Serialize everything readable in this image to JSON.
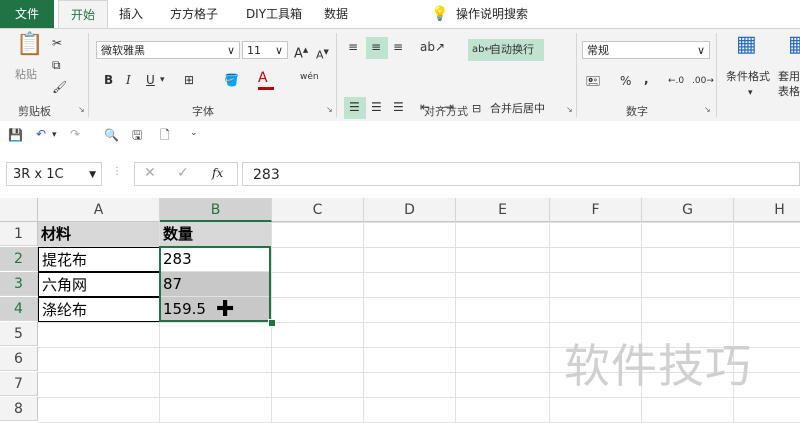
{
  "tabs": [
    {
      "label": "文件"
    },
    {
      "label": "开始"
    },
    {
      "label": "插入"
    },
    {
      "label": "方方格子"
    },
    {
      "label": "DIY工具箱"
    },
    {
      "label": "数据"
    }
  ],
  "tell_me": "操作说明搜索",
  "clipboard": {
    "paste": "粘贴",
    "group": "剪贴板"
  },
  "font": {
    "name": "微软雅黑",
    "size": "11",
    "group": "字体",
    "bold": "B",
    "italic": "I",
    "underline": "U",
    "phonetic": "wén"
  },
  "alignment": {
    "wrap": "自动换行",
    "merge": "合并后居中",
    "group": "对齐方式"
  },
  "number": {
    "format": "常规",
    "group": "数字",
    "percent": "%",
    "comma": ","
  },
  "styles": {
    "cond": "条件格式",
    "table": "套用表格"
  },
  "namebox": "3R x 1C",
  "formula": "283",
  "fx": "fx",
  "columns": [
    "A",
    "B",
    "C",
    "D",
    "E",
    "F",
    "G",
    "H"
  ],
  "rows": [
    "1",
    "2",
    "3",
    "4",
    "5",
    "6",
    "7",
    "8"
  ],
  "cells": {
    "A1": "材料",
    "B1": "数量",
    "A2": "提花布",
    "B2": "283",
    "A3": "六角网",
    "B3": "87",
    "A4": "涤纶布",
    "B4": "159.5"
  },
  "watermark": "软件技巧",
  "accent": "#217346"
}
